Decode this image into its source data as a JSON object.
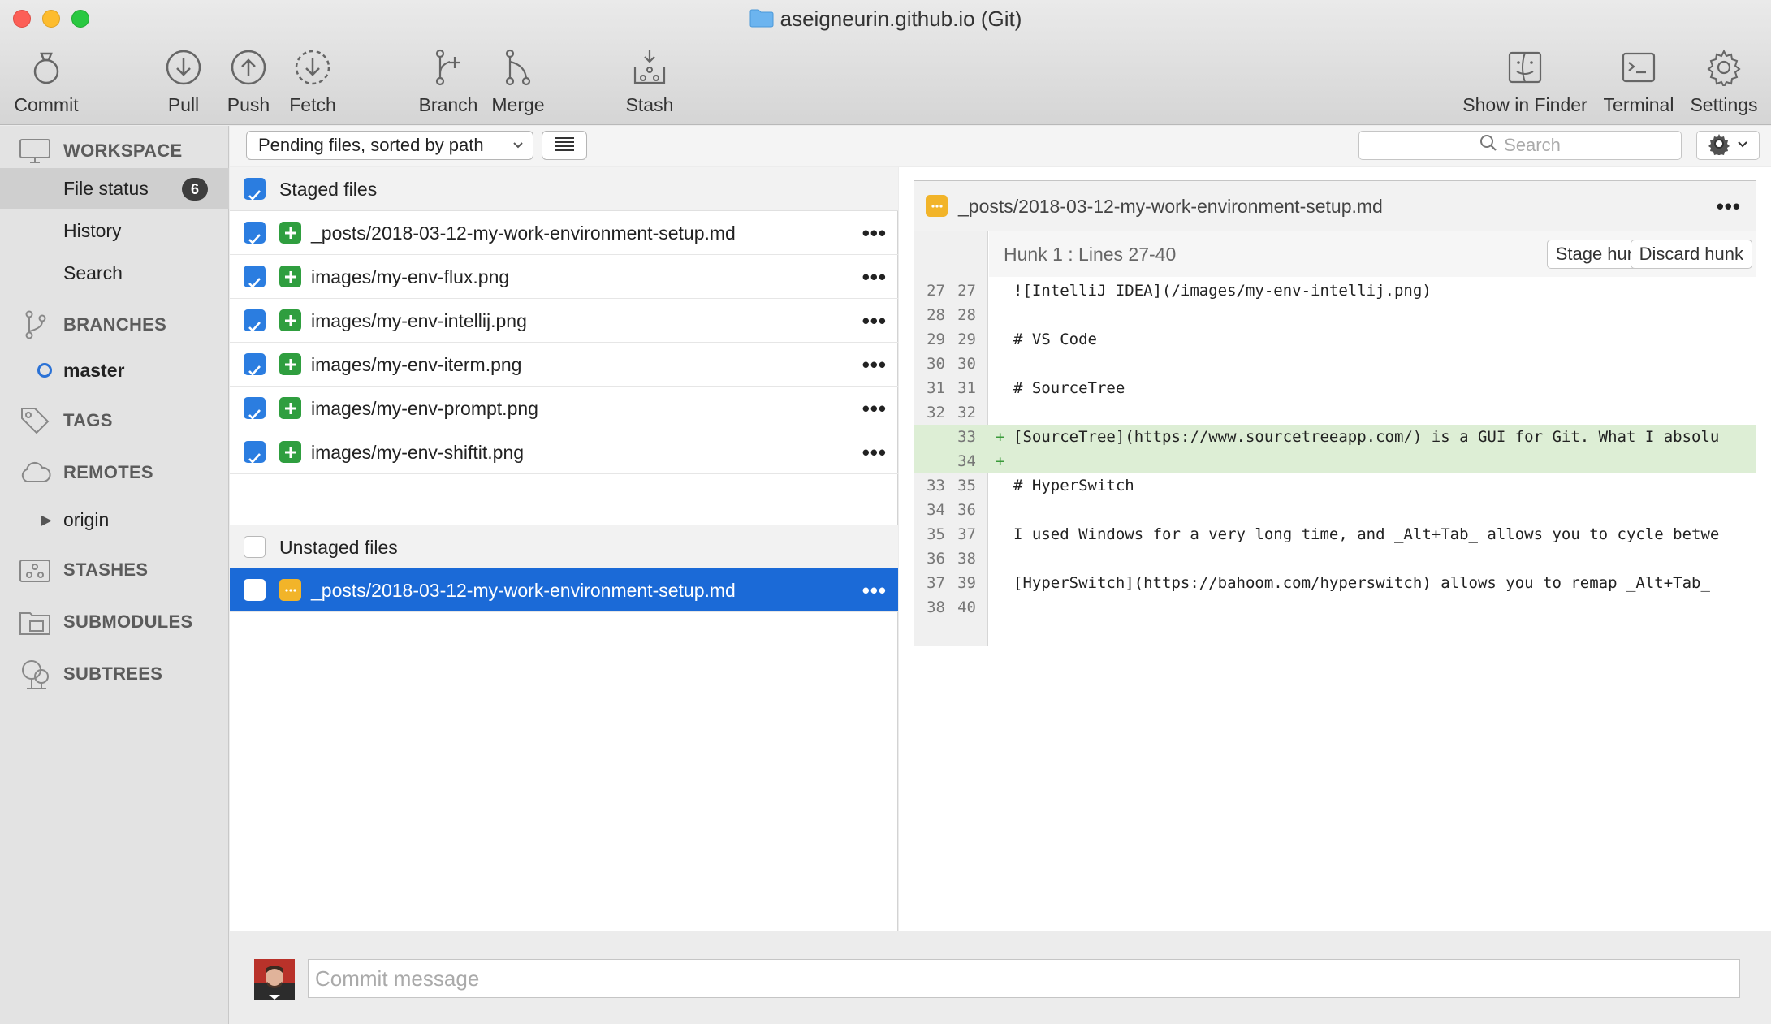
{
  "window": {
    "title": "aseigneurin.github.io (Git)"
  },
  "colors": {
    "accent": "#1b6ad7",
    "added": "#2f9e3f",
    "modified": "#f2b429",
    "added_line_bg": "#ddeed5"
  },
  "toolbar": {
    "commit": "Commit",
    "pull": "Pull",
    "push": "Push",
    "fetch": "Fetch",
    "branch": "Branch",
    "merge": "Merge",
    "stash": "Stash",
    "show_in_finder": "Show in Finder",
    "terminal": "Terminal",
    "settings": "Settings"
  },
  "sidebar": {
    "workspace": "WORKSPACE",
    "file_status": "File status",
    "file_status_count": "6",
    "history": "History",
    "search": "Search",
    "branches": "BRANCHES",
    "current_branch": "master",
    "tags": "TAGS",
    "remotes": "REMOTES",
    "remote_origin": "origin",
    "stashes": "STASHES",
    "submodules": "SUBMODULES",
    "subtrees": "SUBTREES"
  },
  "filebar": {
    "sort_option": "Pending files, sorted by path",
    "search_placeholder": "Search"
  },
  "staged": {
    "header": "Staged files",
    "files": [
      "_posts/2018-03-12-my-work-environment-setup.md",
      "images/my-env-flux.png",
      "images/my-env-intellij.png",
      "images/my-env-iterm.png",
      "images/my-env-prompt.png",
      "images/my-env-shiftit.png"
    ],
    "more": "•••"
  },
  "unstaged": {
    "header": "Unstaged files",
    "files": [
      "_posts/2018-03-12-my-work-environment-setup.md"
    ]
  },
  "diff": {
    "file": "_posts/2018-03-12-my-work-environment-setup.md",
    "more": "•••",
    "hunk_title": "Hunk 1 : Lines 27-40",
    "stage_hunk": "Stage hunk",
    "discard_hunk": "Discard hunk",
    "lines": [
      {
        "old": "27",
        "new": "27",
        "mark": "",
        "text": "![IntelliJ IDEA](/images/my-env-intellij.png)"
      },
      {
        "old": "28",
        "new": "28",
        "mark": "",
        "text": ""
      },
      {
        "old": "29",
        "new": "29",
        "mark": "",
        "text": "# VS Code"
      },
      {
        "old": "30",
        "new": "30",
        "mark": "",
        "text": ""
      },
      {
        "old": "31",
        "new": "31",
        "mark": "",
        "text": "# SourceTree"
      },
      {
        "old": "32",
        "new": "32",
        "mark": "",
        "text": ""
      },
      {
        "old": "",
        "new": "33",
        "mark": "+",
        "text": "[SourceTree](https://www.sourcetreeapp.com/) is a GUI for Git. What I absolu"
      },
      {
        "old": "",
        "new": "34",
        "mark": "+",
        "text": ""
      },
      {
        "old": "33",
        "new": "35",
        "mark": "",
        "text": "# HyperSwitch"
      },
      {
        "old": "34",
        "new": "36",
        "mark": "",
        "text": ""
      },
      {
        "old": "35",
        "new": "37",
        "mark": "",
        "text": "I used Windows for a very long time, and _Alt+Tab_ allows you to cycle betwe"
      },
      {
        "old": "36",
        "new": "38",
        "mark": "",
        "text": ""
      },
      {
        "old": "37",
        "new": "39",
        "mark": "",
        "text": "[HyperSwitch](https://bahoom.com/hyperswitch) allows you to remap _Alt+Tab_"
      },
      {
        "old": "38",
        "new": "40",
        "mark": "",
        "text": ""
      }
    ]
  },
  "commit": {
    "placeholder": "Commit message"
  }
}
